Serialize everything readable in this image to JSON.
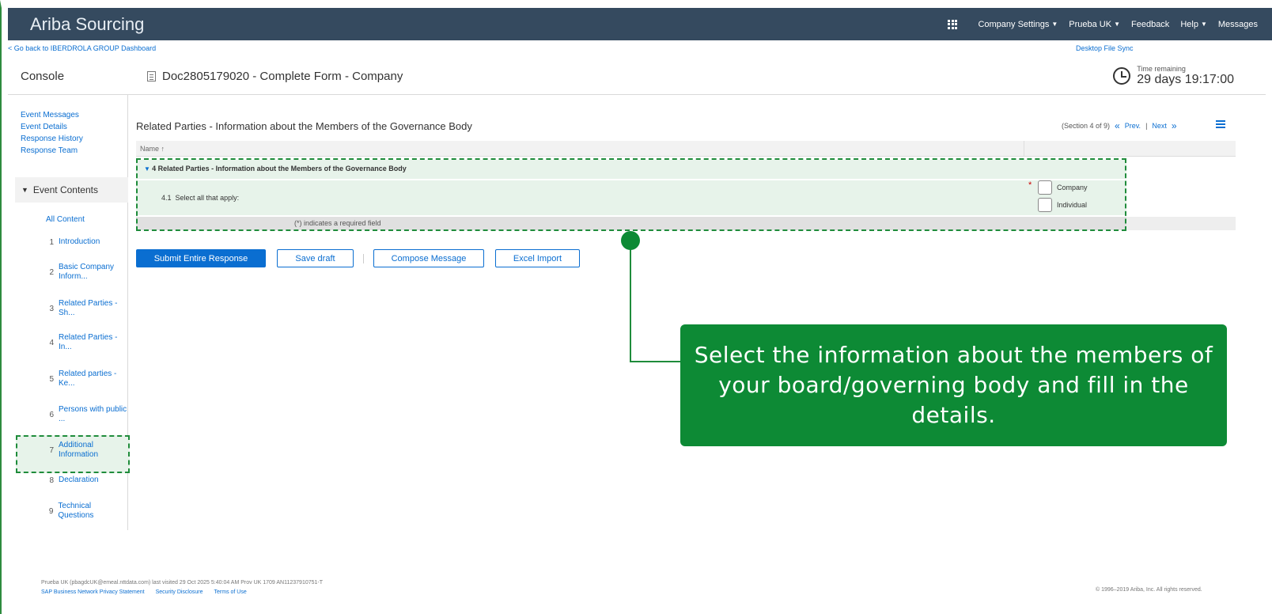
{
  "header": {
    "brand": "Ariba Sourcing",
    "nav": {
      "company_settings": "Company Settings",
      "user": "Prueba UK",
      "feedback": "Feedback",
      "help": "Help",
      "messages": "Messages"
    }
  },
  "subbar": {
    "go_back": "< Go back to IBERDROLA GROUP Dashboard",
    "desktop_sync": "Desktop File Sync"
  },
  "title_row": {
    "console": "Console",
    "doc_title": "Doc2805179020 - Complete Form - Company",
    "time_label": "Time remaining",
    "time_value": "29 days 19:17:00"
  },
  "sidebar": {
    "links": [
      "Event Messages",
      "Event Details",
      "Response History",
      "Response Team"
    ],
    "event_contents": "Event Contents",
    "all_content": "All Content",
    "items": [
      {
        "num": "1",
        "label": "Introduction"
      },
      {
        "num": "2",
        "label": "Basic Company Inform..."
      },
      {
        "num": "3",
        "label": "Related Parties - Sh..."
      },
      {
        "num": "4",
        "label": "Related Parties - In..."
      },
      {
        "num": "5",
        "label": "Related parties - Ke..."
      },
      {
        "num": "6",
        "label": "Persons with public ..."
      },
      {
        "num": "7",
        "label": "Additional Information"
      },
      {
        "num": "8",
        "label": "Declaration"
      },
      {
        "num": "9",
        "label": "Technical Questions"
      }
    ]
  },
  "main": {
    "section_title": "Related Parties - Information about the Members of the Governance Body",
    "section_count": "(Section 4 of 9)",
    "prev": "Prev.",
    "next": "Next",
    "table_header_name": "Name ↑",
    "group_row": "4  Related Parties - Information about the Members of the Governance Body",
    "question_num": "4.1",
    "question_text": "Select all that apply:",
    "options": [
      "Company",
      "Individual"
    ],
    "required_note": "(*) indicates a required field",
    "buttons": {
      "submit": "Submit Entire Response",
      "save_draft": "Save draft",
      "compose": "Compose Message",
      "excel_import": "Excel Import"
    }
  },
  "callout": {
    "text": "Select the information about the members of your board/governing body and fill in the details."
  },
  "footer": {
    "visit": "Prueba UK (pbagdcUK@emeal.nttdata.com) last visited 29 Oct 2025 5:40:04 AM  Prov UK 1709  AN11237910751-T",
    "privacy": "SAP Business Network Privacy Statement",
    "security": "Security Disclosure",
    "terms": "Terms of Use",
    "copyright": "© 1996–2019 Ariba, Inc. All rights reserved."
  },
  "colors": {
    "topbar": "#354a5f",
    "link": "#0a6ed1",
    "highlight_green": "#0d8a35"
  }
}
